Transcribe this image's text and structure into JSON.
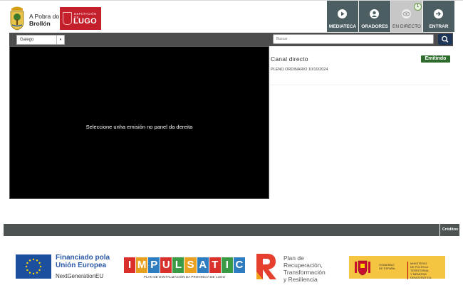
{
  "header": {
    "municipality_line1": "A Pobra do",
    "municipality_line2": "Brollón",
    "deputacion_small": "DEPUTACIÓN DE",
    "deputacion_big": "LUGO"
  },
  "nav": {
    "items": [
      {
        "label": "MEDIATECA",
        "icon": "play-icon"
      },
      {
        "label": "ORADORES",
        "icon": "user-icon"
      },
      {
        "label": "EN DIRECTO",
        "icon": "eye-icon",
        "badge": "1"
      },
      {
        "label": "ENTRAR",
        "icon": "arrow-right-icon"
      }
    ]
  },
  "toolbar": {
    "language_selected": "Galego",
    "search_placeholder": "Buscar"
  },
  "player": {
    "message": "Seleccione unha emisión no panel da dereita"
  },
  "live_panel": {
    "channel_title": "Canal directo",
    "status": "Emitindo",
    "events": [
      "PLENO ORDINARIO 10/10/2024"
    ]
  },
  "footer": {
    "credits_label": "Créditos"
  },
  "funding": {
    "eu_line1": "Financiado pola",
    "eu_line2": "Unión Europea",
    "eu_sub": "NextGenerationEU",
    "impulsatic_letters": [
      "I",
      "M",
      "P",
      "U",
      "L",
      "S",
      "A",
      "T",
      "I",
      "C"
    ],
    "impulsatic_sub": "PLAN DE DIXITALIZACIÓN DA PROVINCIA DE LUGO",
    "prtr_line1": "Plan de",
    "prtr_line2": "Recuperación,",
    "prtr_line3": "Transformación",
    "prtr_line4": "y Resiliencia",
    "gov_line1": "GOBIERNO",
    "gov_line2": "DE ESPAÑA",
    "ministry_line1": "MINISTERIO",
    "ministry_line2": "DE POLÍTICA TERRITORIAL",
    "ministry_line3": "Y MEMORIA DEMOCRÁTICA"
  },
  "colors": {
    "nav_bg": "#4d5e63",
    "nav_active_bg": "#c7c7c7",
    "status_green": "#2e6b2c",
    "search_button": "#1d3557",
    "deputacion_red": "#c3202b"
  }
}
